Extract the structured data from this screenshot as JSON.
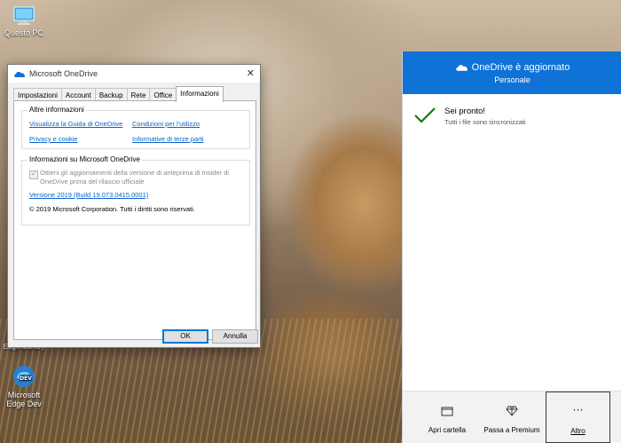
{
  "desktop": {
    "icons": [
      {
        "label": "Questo PC"
      },
      {
        "label": "Edge Canary"
      },
      {
        "label_line1": "Microsoft",
        "label_line2": "Edge Dev"
      }
    ]
  },
  "dialog": {
    "title": "Microsoft OneDrive",
    "tabs": [
      "Impostazioni",
      "Account",
      "Backup",
      "Rete",
      "Office",
      "Informazioni"
    ],
    "active_tab": "Informazioni",
    "more_info": {
      "title": "Altre informazioni",
      "links": [
        "Visualizza la Guida di OneDrive",
        "Condizioni per l'utilizzo",
        "Privacy e cookie",
        "Informative di terze parti"
      ]
    },
    "about": {
      "title": "Informazioni su Microsoft OneDrive",
      "insider_line1": "Ottieni gli aggiornamenti della versione di anteprima di Insider di",
      "insider_line2": "OneDrive prima del rilascio ufficiale",
      "version": "Versione 2019 (Build 19.073.0415.0001)",
      "copyright": "© 2019 Microsoft Corporation. Tutti i diritti sono riservati."
    },
    "buttons": {
      "ok": "OK",
      "cancel": "Annulla"
    }
  },
  "flyout": {
    "title": "OneDrive è aggiornato",
    "subtitle": "Personale",
    "status_title": "Sei pronto!",
    "status_sub": "Tutti i file sono sincronizzati",
    "footer": {
      "open_folder": "Apri cartella",
      "premium": "Passa a Premium",
      "more": "Altro"
    },
    "accent": "#0f72d6",
    "check_color": "#107c10"
  }
}
